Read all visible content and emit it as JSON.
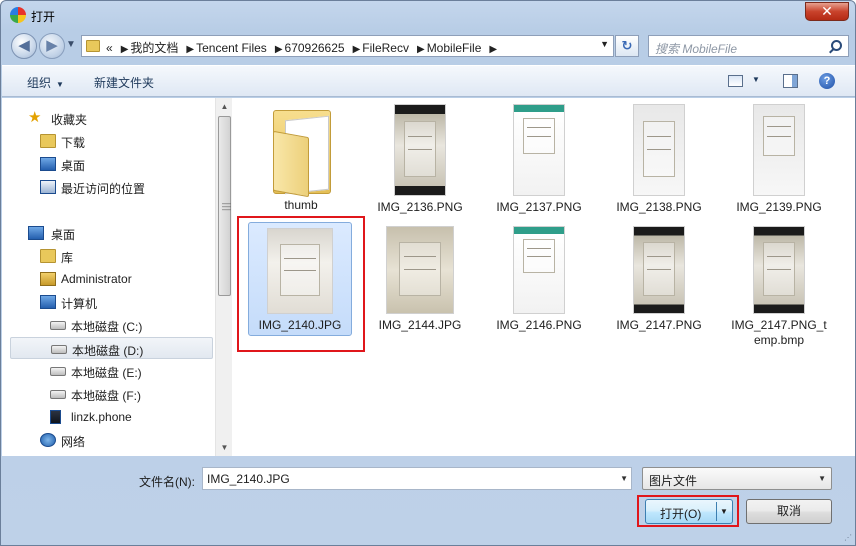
{
  "window": {
    "title": "打开",
    "close_glyph": "✕"
  },
  "nav": {
    "back_glyph": "◀",
    "forward_glyph": "▶",
    "breadcrumb": [
      "我的文档",
      "Tencent Files",
      "670926625",
      "FileRecv",
      "MobileFile"
    ],
    "breadcrumb_overflow": "«",
    "search_placeholder": "搜索 MobileFile",
    "refresh_glyph": "↻"
  },
  "toolbar": {
    "organize_label": "组织",
    "new_folder_label": "新建文件夹",
    "help_glyph": "?"
  },
  "sidebar": {
    "items": [
      {
        "label": "收藏夹",
        "icon": "star-icon"
      },
      {
        "label": "下载",
        "icon": "downloads-folder-icon"
      },
      {
        "label": "桌面",
        "icon": "desktop-icon"
      },
      {
        "label": "最近访问的位置",
        "icon": "recent-places-icon"
      },
      {
        "label": "桌面",
        "icon": "desktop-icon"
      },
      {
        "label": "库",
        "icon": "library-icon"
      },
      {
        "label": "Administrator",
        "icon": "user-folder-icon"
      },
      {
        "label": "计算机",
        "icon": "computer-icon"
      },
      {
        "label": "本地磁盘 (C:)",
        "icon": "drive-icon"
      },
      {
        "label": "本地磁盘 (D:)",
        "icon": "drive-icon",
        "selected": true
      },
      {
        "label": "本地磁盘 (E:)",
        "icon": "drive-icon"
      },
      {
        "label": "本地磁盘 (F:)",
        "icon": "drive-icon"
      },
      {
        "label": "linzk.phone",
        "icon": "phone-icon"
      },
      {
        "label": "网络",
        "icon": "network-icon"
      }
    ]
  },
  "files": [
    {
      "name": "thumb",
      "kind": "folder"
    },
    {
      "name": "IMG_2136.PNG",
      "kind": "image"
    },
    {
      "name": "IMG_2137.PNG",
      "kind": "image"
    },
    {
      "name": "IMG_2138.PNG",
      "kind": "image"
    },
    {
      "name": "IMG_2139.PNG",
      "kind": "image"
    },
    {
      "name": "IMG_2140.JPG",
      "kind": "image",
      "selected": true
    },
    {
      "name": "IMG_2144.JPG",
      "kind": "image"
    },
    {
      "name": "IMG_2146.PNG",
      "kind": "image"
    },
    {
      "name": "IMG_2147.PNG",
      "kind": "image"
    },
    {
      "name": "IMG_2147.PNG_temp.bmp",
      "kind": "image"
    }
  ],
  "footer": {
    "filename_label": "文件名(N):",
    "filename_value": "IMG_2140.JPG",
    "filetype_value": "图片文件",
    "open_label": "打开(O)",
    "cancel_label": "取消"
  },
  "colors": {
    "highlight": "#e0161b",
    "selection": "#c5dcfa",
    "chrome": "#bed1e8"
  }
}
